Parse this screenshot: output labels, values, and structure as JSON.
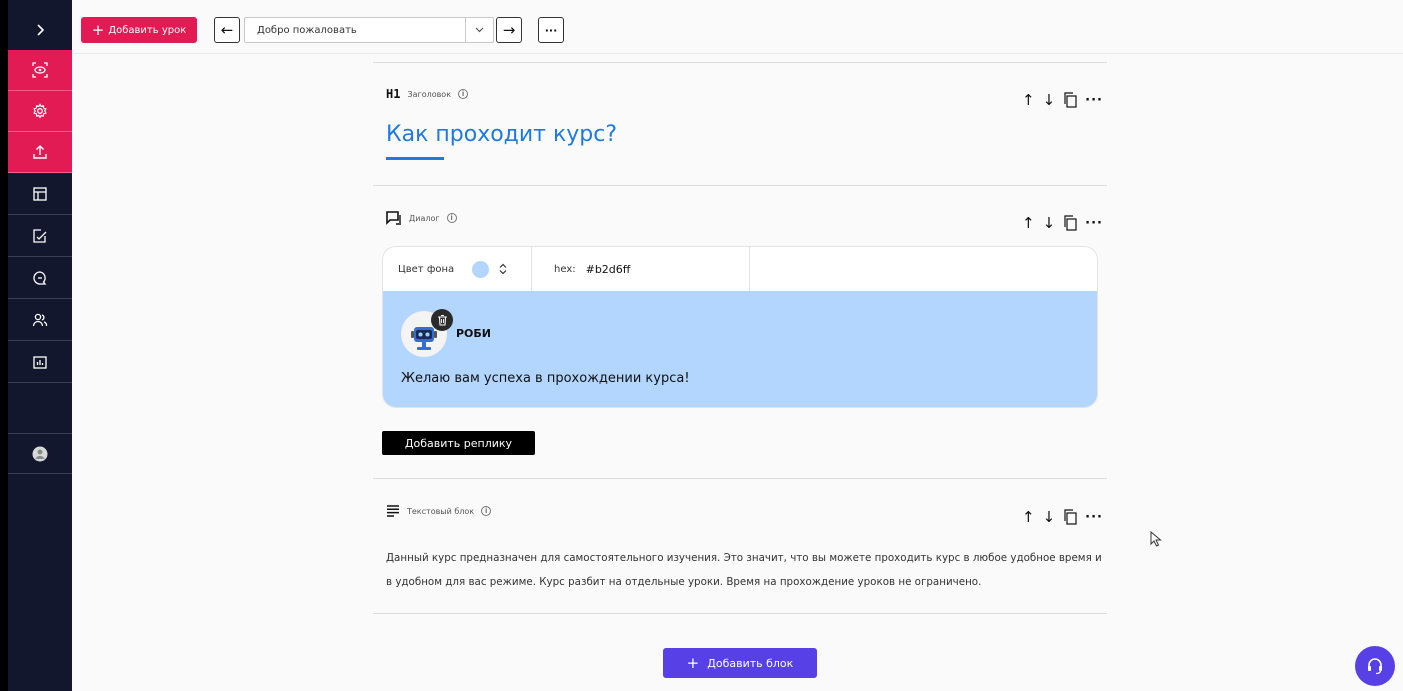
{
  "sidebar": {
    "items": [
      {
        "icon": "chevron-right-icon"
      },
      {
        "icon": "eye-preview-icon"
      },
      {
        "icon": "gear-icon"
      },
      {
        "icon": "upload-icon"
      },
      {
        "icon": "layout-icon"
      },
      {
        "icon": "edit-document-icon"
      },
      {
        "icon": "chat-search-icon"
      },
      {
        "icon": "users-icon"
      },
      {
        "icon": "analytics-icon"
      },
      {
        "icon": "profile-avatar-icon"
      }
    ]
  },
  "toolbar": {
    "add_lesson_label": "Добавить урок",
    "lesson_select_value": "Добро пожаловать",
    "prev_glyph": "←",
    "next_glyph": "→",
    "more_glyph": "···"
  },
  "blocks": {
    "heading": {
      "tag": "H1",
      "type_label": "Заголовок",
      "text": "Как проходит курс?"
    },
    "dialog": {
      "type_label": "Диалог",
      "bg_label": "Цвет фона",
      "hex_label": "hex:",
      "hex_value": "#b2d6ff",
      "speaker": "РОБИ",
      "replica": "Желаю вам успеха в прохождении курса!",
      "add_reply_label": "Добавить реплику"
    },
    "text": {
      "type_label": "Текстовый блок",
      "body": "Данный курс предназначен для самостоятельного изучения. Это значит, что вы можете проходить курс в любое удобное время и в удобном для вас режиме. Курс разбит на отдельные уроки. Время на прохождение уроков не ограничено."
    }
  },
  "block_tools": {
    "up": "↑",
    "down": "↓",
    "more": "···"
  },
  "add_block_label": "Добавить блок",
  "colors": {
    "accent_red": "#e31b54",
    "accent_blue": "#1f7ae0",
    "accent_purple": "#5640e6",
    "dialog_bg": "#b2d6ff"
  }
}
